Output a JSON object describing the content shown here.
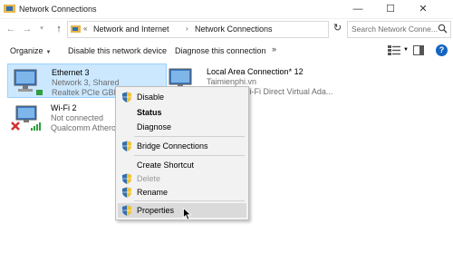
{
  "window": {
    "title": "Network Connections",
    "controls": [
      "—",
      "☐",
      "✕"
    ]
  },
  "address": {
    "chevron": "«",
    "crumbs": [
      "Network and Internet",
      "Network Connections"
    ],
    "search_placeholder": "Search Network Conne..."
  },
  "commands": {
    "organize": "Organize",
    "disable": "Disable this network device",
    "diagnose": "Diagnose this connection",
    "more": "»"
  },
  "connections": [
    {
      "name": "Ethernet 3",
      "status": "Network 3, Shared",
      "device": "Realtek PCIe GBE Family Co...",
      "selected": true
    },
    {
      "name": "Local Area Connection* 12",
      "status": "Taimienphi.vn",
      "device": "Microsoft Wi-Fi Direct Virtual Ada...",
      "selected": false
    },
    {
      "name": "Wi-Fi 2",
      "status": "Not connected",
      "device": "Qualcomm Atheros Q...",
      "selected": false
    }
  ],
  "context_menu": [
    {
      "label": "Disable",
      "shield": true,
      "bold": false,
      "disabled": false
    },
    {
      "label": "Status",
      "shield": false,
      "bold": true,
      "disabled": false
    },
    {
      "label": "Diagnose",
      "shield": false,
      "bold": false,
      "disabled": false
    },
    {
      "label": "Bridge Connections",
      "shield": true,
      "bold": false,
      "disabled": false
    },
    {
      "label": "Create Shortcut",
      "shield": false,
      "bold": false,
      "disabled": false
    },
    {
      "label": "Delete",
      "shield": true,
      "bold": false,
      "disabled": true
    },
    {
      "label": "Rename",
      "shield": true,
      "bold": false,
      "disabled": false
    },
    {
      "label": "Properties",
      "shield": true,
      "bold": false,
      "disabled": false,
      "hover": true
    }
  ],
  "colors": {
    "selection_bg": "#cce8ff",
    "menu_bg": "#f2f2f2",
    "help_blue": "#1565c0",
    "error_red": "#d32f2f",
    "signal_green": "#2e9e3e"
  },
  "icons": {
    "app": "network-folder-icon",
    "adapter": "network-adapter-icon",
    "shield": "uac-shield-icon"
  }
}
